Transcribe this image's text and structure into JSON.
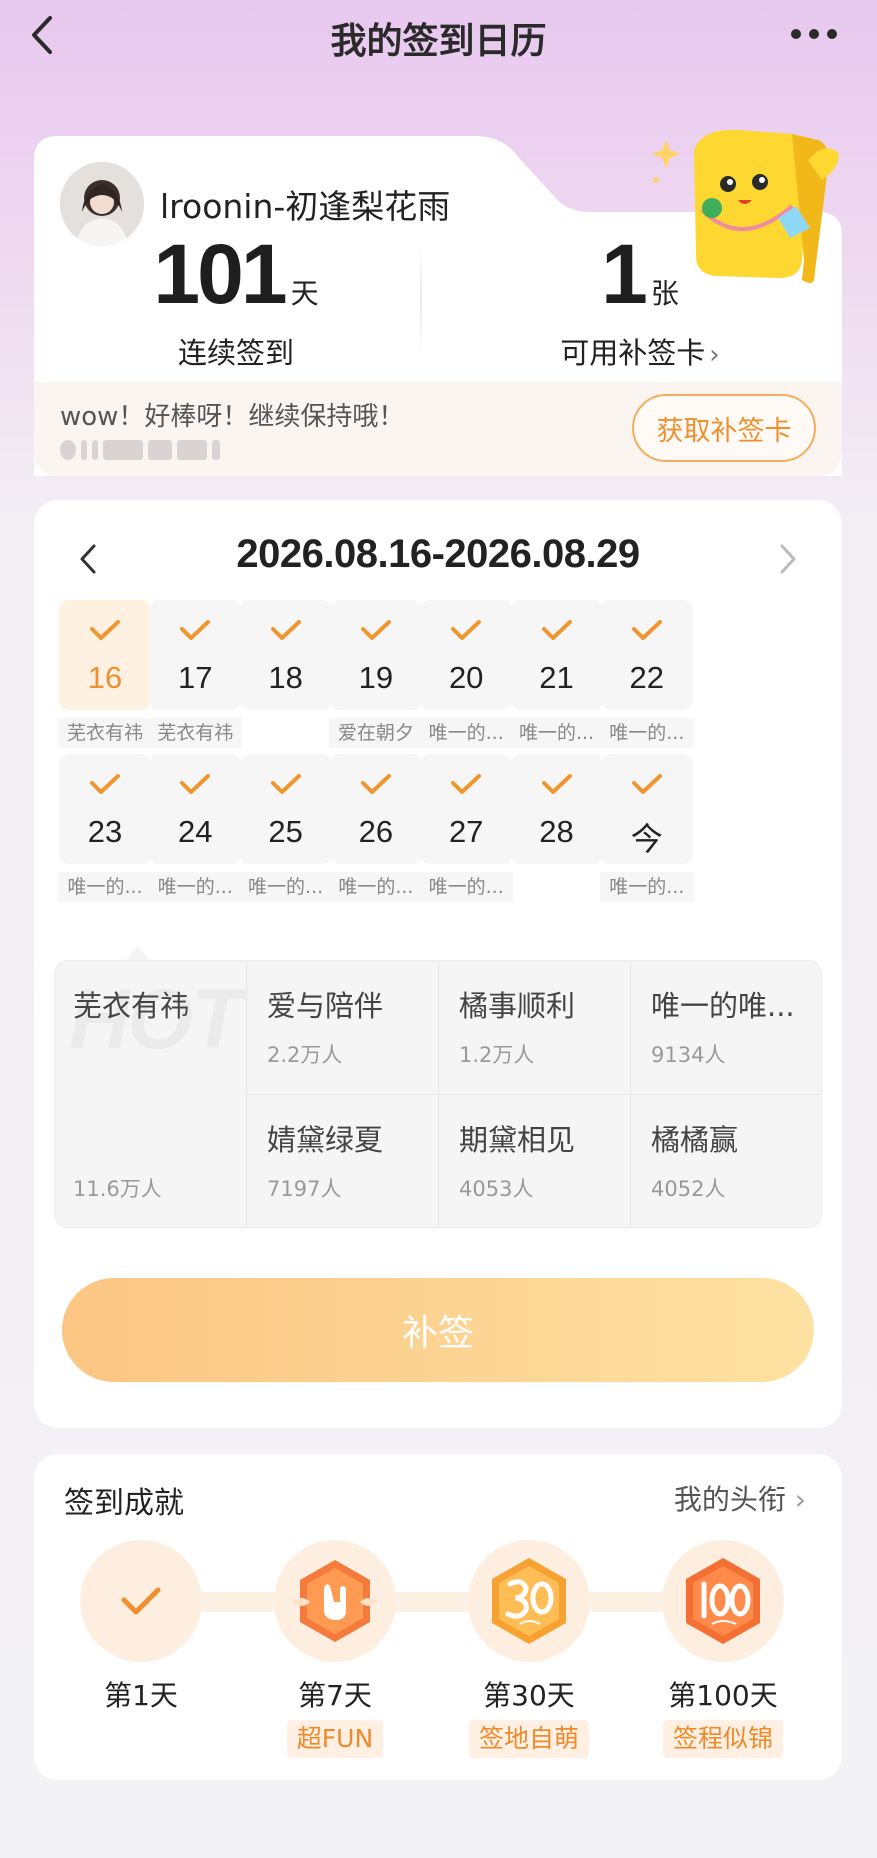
{
  "nav": {
    "title": "我的签到日历"
  },
  "profile": {
    "username": "lroonin-初逢梨花雨",
    "streak_days": "101",
    "streak_unit": "天",
    "streak_label": "连续签到",
    "makeup_cards": "1",
    "makeup_unit": "张",
    "makeup_label": "可用补签卡",
    "message": "wow！好棒呀！继续保持哦！",
    "get_card_button": "获取补签卡"
  },
  "calendar": {
    "range": "2026.08.16-2026.08.29",
    "days": [
      {
        "num": "16",
        "tag": "芜衣有祎",
        "highlight": true
      },
      {
        "num": "17",
        "tag": "芜衣有祎"
      },
      {
        "num": "18",
        "tag": ""
      },
      {
        "num": "19",
        "tag": "爱在朝夕"
      },
      {
        "num": "20",
        "tag": "唯一的..."
      },
      {
        "num": "21",
        "tag": "唯一的..."
      },
      {
        "num": "22",
        "tag": "唯一的..."
      },
      {
        "num": "23",
        "tag": "唯一的..."
      },
      {
        "num": "24",
        "tag": "唯一的..."
      },
      {
        "num": "25",
        "tag": "唯一的..."
      },
      {
        "num": "26",
        "tag": "唯一的..."
      },
      {
        "num": "27",
        "tag": "唯一的..."
      },
      {
        "num": "28",
        "tag": ""
      },
      {
        "num": "今",
        "tag": "唯一的..."
      }
    ]
  },
  "hot_list": {
    "watermark": "HOT",
    "top": {
      "name": "芜衣有祎",
      "count": "11.6万人"
    },
    "items": [
      {
        "name": "爱与陪伴",
        "count": "2.2万人"
      },
      {
        "name": "橘事顺利",
        "count": "1.2万人"
      },
      {
        "name": "唯一的唯...",
        "count": "9134人"
      },
      {
        "name": "婧黛绿夏",
        "count": "7197人"
      },
      {
        "name": "期黛相见",
        "count": "4053人"
      },
      {
        "name": "橘橘赢",
        "count": "4052人"
      }
    ]
  },
  "makeup_button": "补签",
  "achievements": {
    "heading": "签到成就",
    "my_title": "我的头衔",
    "badges": [
      {
        "day": "第1天",
        "tag": "",
        "icon": "check-icon"
      },
      {
        "day": "第7天",
        "tag": "超FUN",
        "icon": "rock-hand-badge-icon"
      },
      {
        "day": "第30天",
        "tag": "签地自萌",
        "icon": "30-days-badge-icon"
      },
      {
        "day": "第100天",
        "tag": "签程似锦",
        "icon": "100-days-badge-icon"
      }
    ]
  },
  "colors": {
    "accent": "#ef8f2d",
    "button_gradient_start": "#fcc27c",
    "button_gradient_end": "#fde09d"
  }
}
